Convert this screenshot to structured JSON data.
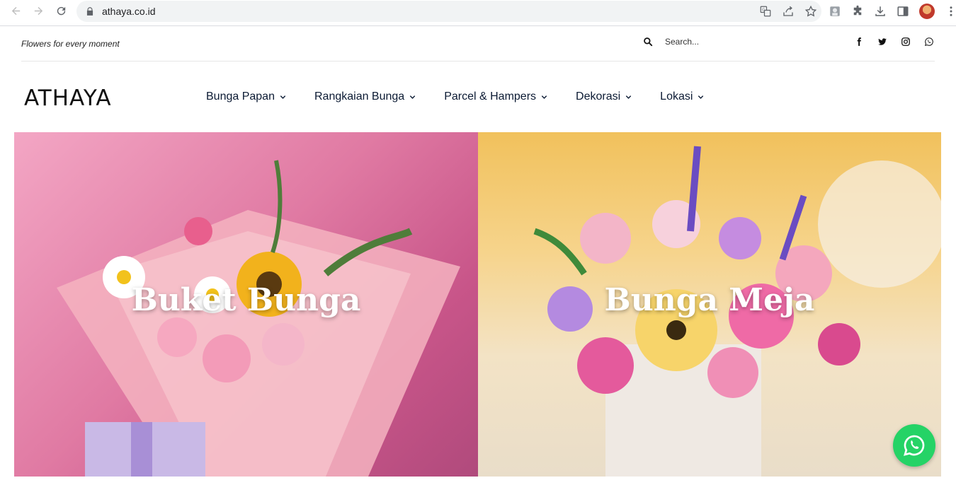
{
  "browser": {
    "url": "athaya.co.id",
    "icons": [
      "back-icon",
      "forward-icon",
      "reload-icon",
      "lock-icon",
      "translate-icon",
      "share-icon",
      "bookmark-star-icon",
      "extension-profile-icon",
      "puzzle-icon",
      "download-icon",
      "side-panel-icon",
      "avatar",
      "more-menu-icon"
    ]
  },
  "topbar": {
    "tagline": "Flowers for every moment",
    "search_placeholder": "Search...",
    "socials": [
      "facebook-icon",
      "twitter-icon",
      "instagram-icon",
      "whatsapp-icon"
    ]
  },
  "header": {
    "logo": "ATHAYA",
    "nav": [
      {
        "label": "Bunga Papan"
      },
      {
        "label": "Rangkaian Bunga"
      },
      {
        "label": "Parcel & Hampers"
      },
      {
        "label": "Dekorasi"
      },
      {
        "label": "Lokasi"
      }
    ]
  },
  "tiles": [
    {
      "title": "Buket Bunga"
    },
    {
      "title": "Bunga Meja"
    }
  ],
  "colors": {
    "whatsapp": "#25d366",
    "nav_text": "#0b1a33",
    "left_tile": "#e07aa3",
    "right_tile": "#f1c15c"
  }
}
